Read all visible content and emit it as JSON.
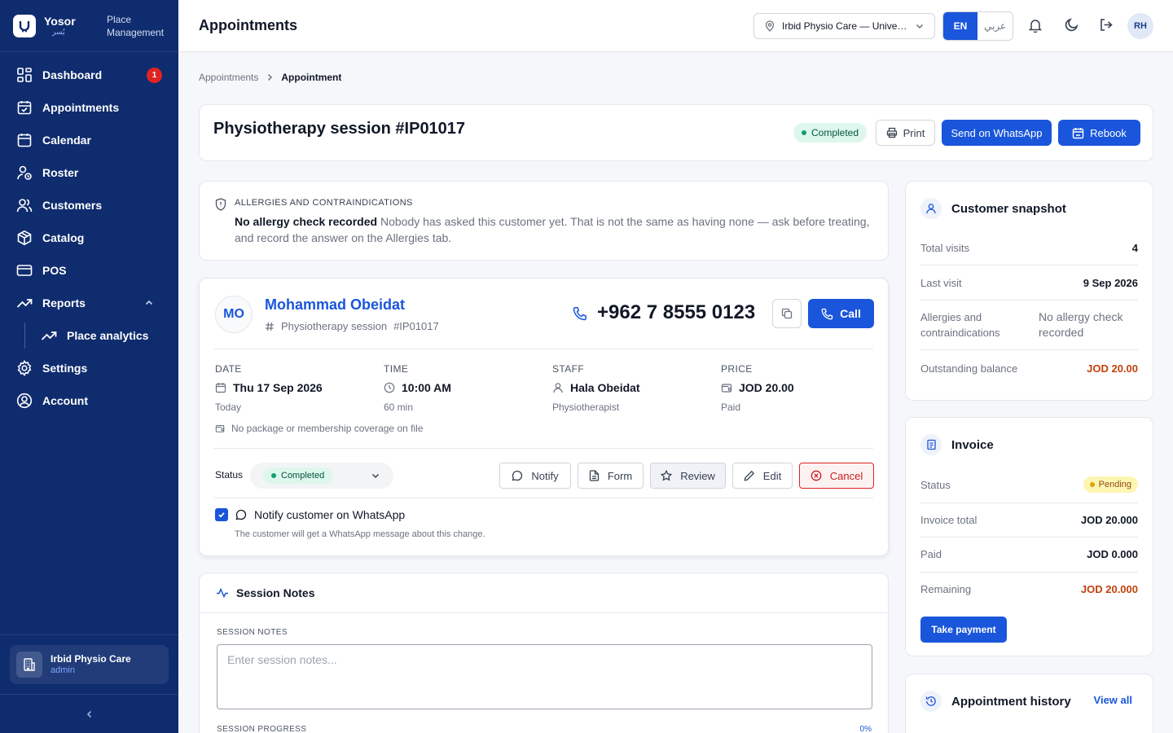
{
  "brand": {
    "name": "Yosor",
    "name_ar": "يُسر",
    "subtitle": "Place Management"
  },
  "sidebar": {
    "items": [
      {
        "label": "Dashboard",
        "badge": "1"
      },
      {
        "label": "Appointments"
      },
      {
        "label": "Calendar"
      },
      {
        "label": "Roster"
      },
      {
        "label": "Customers"
      },
      {
        "label": "Catalog"
      },
      {
        "label": "POS"
      },
      {
        "label": "Reports"
      }
    ],
    "sub_items": [
      {
        "label": "Place analytics"
      }
    ],
    "after": [
      {
        "label": "Settings"
      },
      {
        "label": "Account"
      }
    ],
    "place": {
      "name": "Irbid Physio Care",
      "role": "admin"
    }
  },
  "header": {
    "title": "Appointments",
    "location": "Irbid Physio Care — University Street",
    "lang_active": "EN",
    "lang_other": "عربي",
    "user_initials": "RH"
  },
  "breadcrumb": {
    "parent": "Appointments",
    "current": "Appointment"
  },
  "session": {
    "title": "Physiotherapy session #IP01017",
    "status": "Completed",
    "print_label": "Print",
    "whatsapp_label": "Send on WhatsApp",
    "rebook_label": "Rebook"
  },
  "allergies": {
    "heading": "ALLERGIES AND CONTRAINDICATIONS",
    "bold": "No allergy check recorded",
    "text": "Nobody has asked this customer yet. That is not the same as having none — ask before treating, and record the answer on the Allergies tab."
  },
  "appointment": {
    "initials": "MO",
    "customer": "Mohammad Obeidat",
    "subtitle": "Physiotherapy session",
    "code": "#IP01017",
    "phone": "+962 7 8555 0123",
    "call_label": "Call",
    "date": {
      "label": "DATE",
      "value": "Thu 17 Sep 2026",
      "sub": "Today"
    },
    "time": {
      "label": "TIME",
      "value": "10:00 AM",
      "sub": "60 min"
    },
    "staff": {
      "label": "STAFF",
      "value": "Hala Obeidat",
      "sub": "Physiotherapist"
    },
    "price": {
      "label": "PRICE",
      "value": "JOD 20.00",
      "sub": "Paid"
    },
    "coverage": "No package or membership coverage on file",
    "status_label": "Status",
    "status_value": "Completed",
    "actions": {
      "notify": "Notify",
      "form": "Form",
      "review": "Review",
      "edit": "Edit",
      "cancel": "Cancel"
    },
    "notify_whatsapp": "Notify customer on WhatsApp",
    "notify_sub": "The customer will get a WhatsApp message about this change."
  },
  "notes": {
    "title": "Session Notes",
    "label": "SESSION NOTES",
    "placeholder": "Enter session notes...",
    "progress_label": "SESSION PROGRESS",
    "progress_value": "0%"
  },
  "snapshot": {
    "title": "Customer snapshot",
    "total_visits_label": "Total visits",
    "total_visits": "4",
    "last_visit_label": "Last visit",
    "last_visit": "9 Sep 2026",
    "allergies_label": "Allergies and contraindications",
    "allergies_value": "No allergy check recorded",
    "balance_label": "Outstanding balance",
    "balance": "JOD 20.00"
  },
  "invoice": {
    "title": "Invoice",
    "status_label": "Status",
    "status": "Pending",
    "total_label": "Invoice total",
    "total": "JOD 20.000",
    "paid_label": "Paid",
    "paid": "JOD 0.000",
    "remaining_label": "Remaining",
    "remaining": "JOD 20.000",
    "pay_label": "Take payment"
  },
  "history": {
    "title": "Appointment history",
    "view_all": "View all"
  },
  "colors": {
    "sidebar": "#0f2c6e",
    "primary": "#1a56db",
    "danger": "#e02424",
    "success": "#0e9f6e",
    "warning": "#c2410c"
  }
}
